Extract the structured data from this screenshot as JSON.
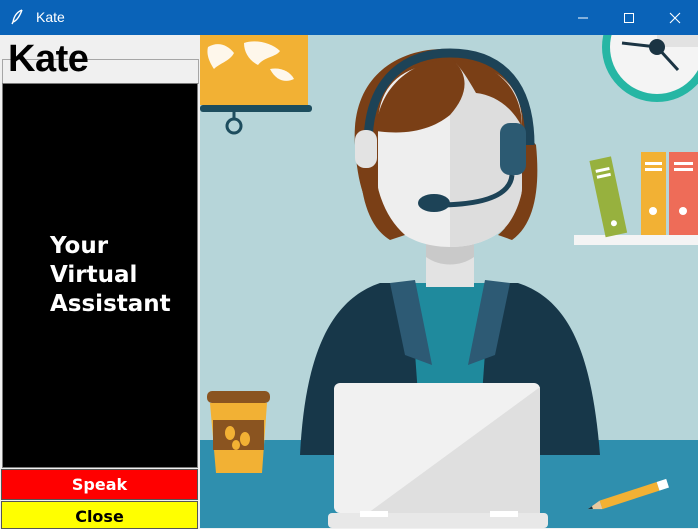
{
  "window": {
    "title": "Kate",
    "controls": [
      "minimize-icon",
      "maximize-icon",
      "close-icon"
    ],
    "titlebar_color": "#0a63b8"
  },
  "app": {
    "brand": "Kate",
    "tagline": [
      "Your",
      "Virtual",
      "Assistant"
    ]
  },
  "buttons": {
    "speak": "Speak",
    "close": "Close"
  },
  "colors": {
    "speak_bg": "#ff0000",
    "close_bg": "#ffff00",
    "panel_bg": "#000000",
    "scene_bg": "#b6d5d9"
  },
  "illustration": {
    "subject": "customer support agent with headset at laptop",
    "icons": [
      "world-map-icon",
      "wall-clock-icon",
      "bookshelf-icon",
      "coffee-cup-icon",
      "pencil-icon",
      "laptop-icon"
    ]
  }
}
